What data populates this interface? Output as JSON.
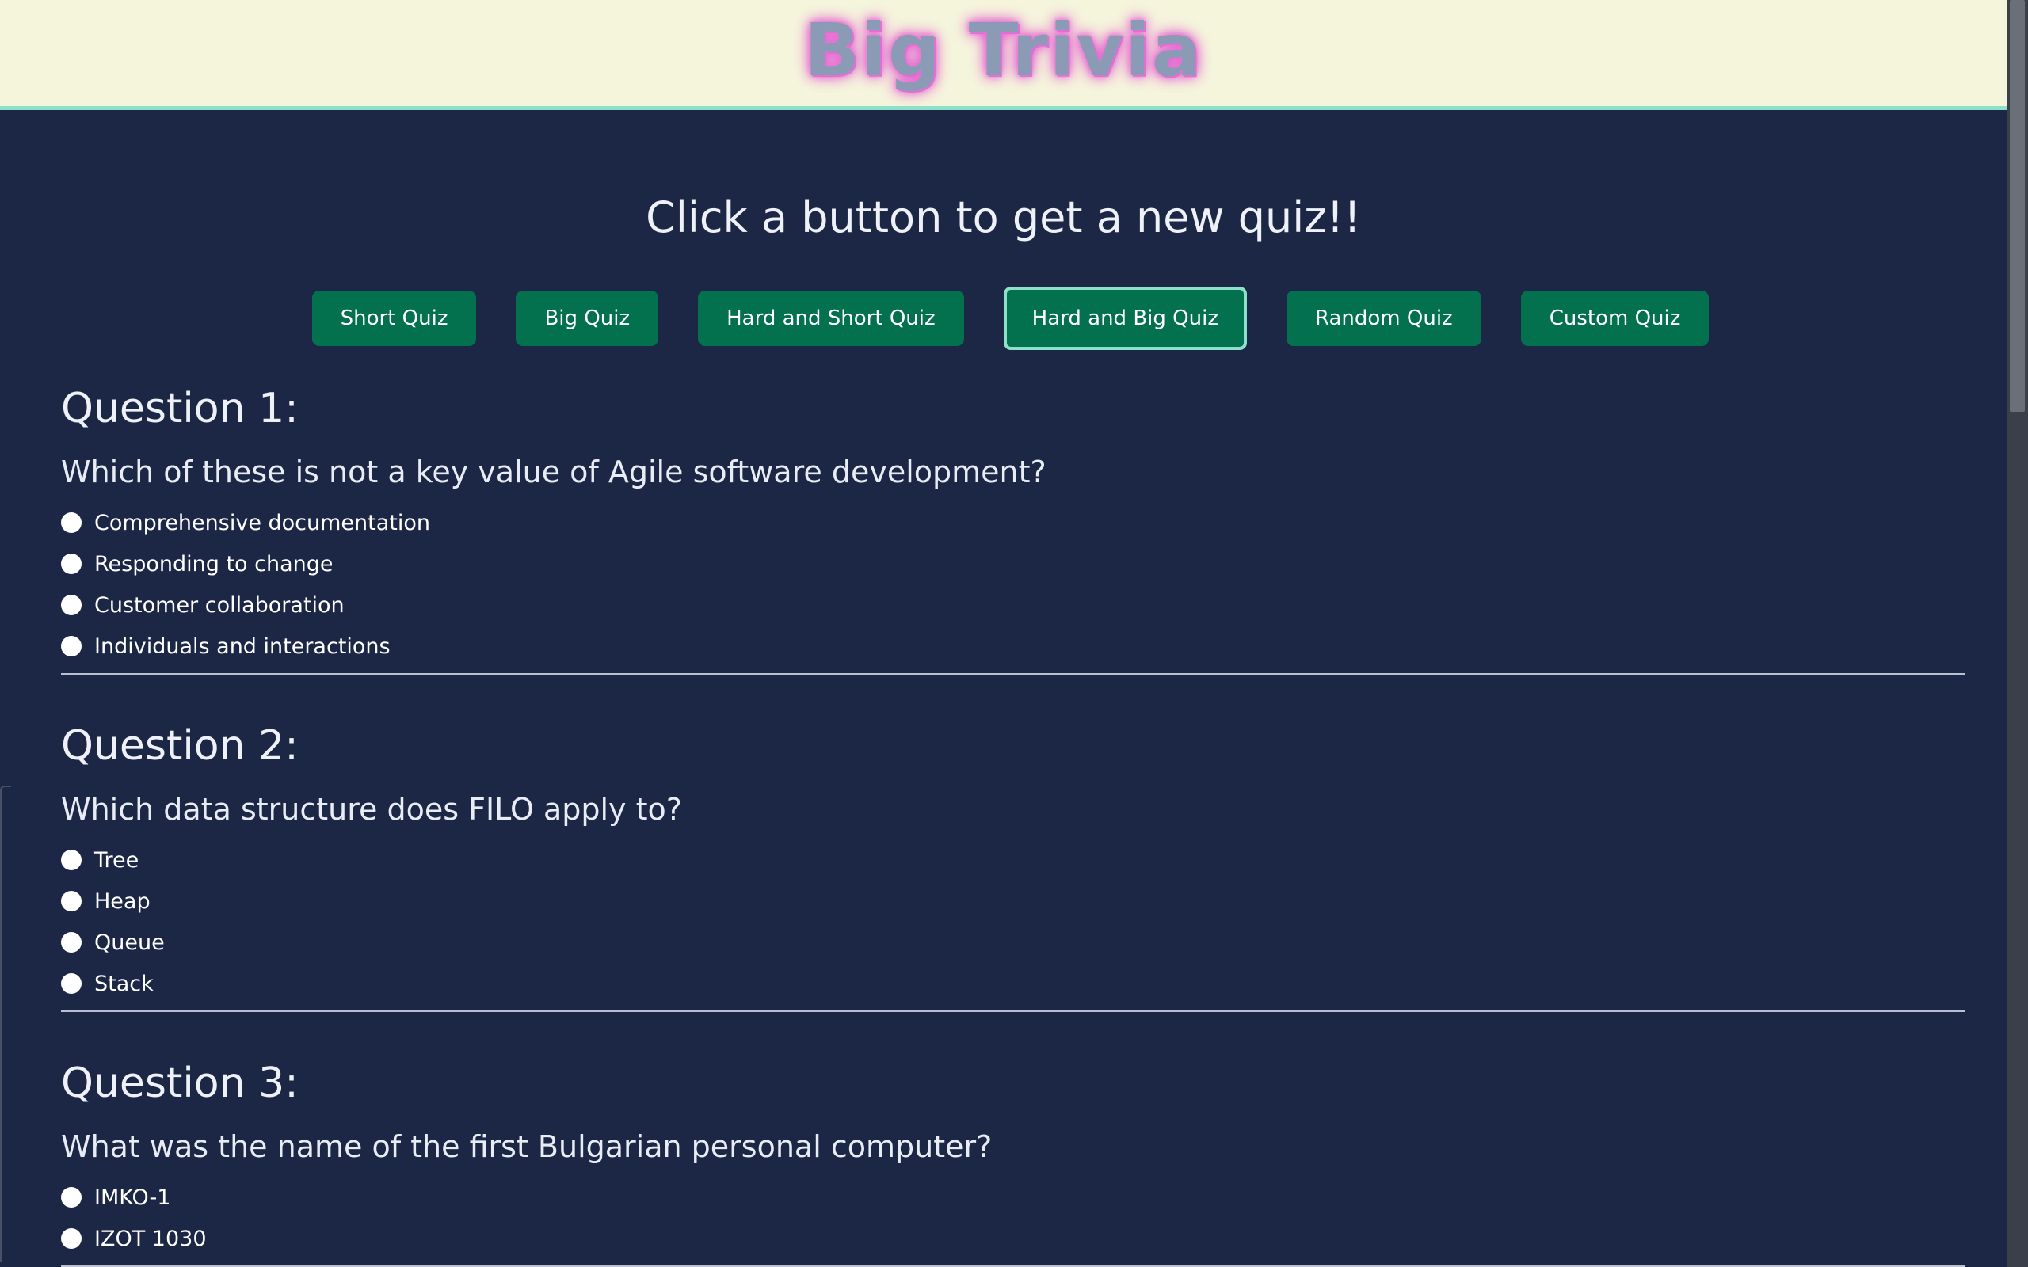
{
  "header": {
    "logo_text": "Big Trivia"
  },
  "main": {
    "prompt": "Click a button to get a new quiz!!",
    "buttons": [
      {
        "label": "Short Quiz"
      },
      {
        "label": "Big Quiz"
      },
      {
        "label": "Hard and Short Quiz"
      },
      {
        "label": "Hard and Big Quiz",
        "focused": true
      },
      {
        "label": "Random Quiz"
      },
      {
        "label": "Custom Quiz"
      }
    ],
    "questions": [
      {
        "title": "Question 1:",
        "text": "Which of these is not a key value of Agile software development?",
        "options": [
          "Comprehensive documentation",
          "Responding to change",
          "Customer collaboration",
          "Individuals and interactions"
        ]
      },
      {
        "title": "Question 2:",
        "text": "Which data structure does FILO apply to?",
        "options": [
          "Tree",
          "Heap",
          "Queue",
          "Stack"
        ]
      },
      {
        "title": "Question 3:",
        "text": "What was the name of the first Bulgarian personal computer?",
        "options": [
          "IMKO-1",
          "IZOT 1030"
        ]
      }
    ]
  },
  "colors": {
    "background": "#1c2645",
    "header_bg": "#f5f5dc",
    "button_bg": "#03704e",
    "focus_ring": "#8de1c9",
    "logo_glow": "#e35ad0"
  }
}
